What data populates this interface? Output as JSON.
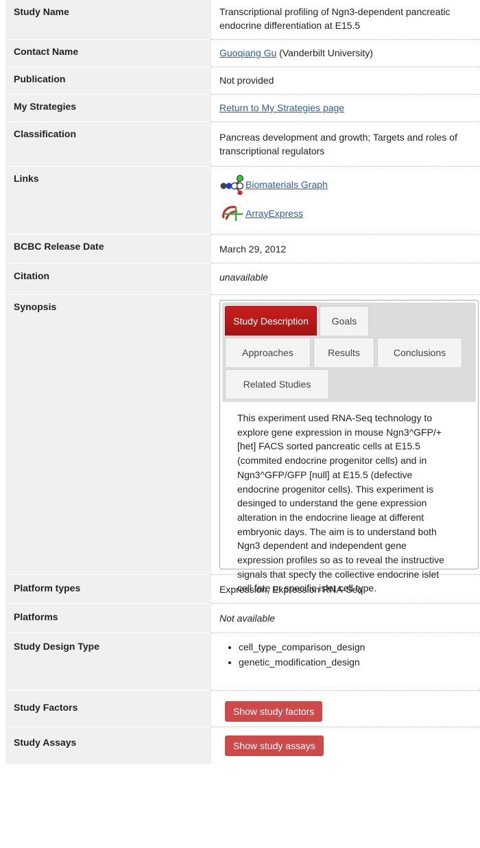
{
  "rows": {
    "study_name": {
      "label": "Study Name",
      "value": "Transcriptional profiling of Ngn3-dependent pancreatic endocrine differentiation at E15.5"
    },
    "contact": {
      "label": "Contact Name",
      "link": "Guoqiang Gu",
      "suffix": " (Vanderbilt University)"
    },
    "publication": {
      "label": "Publication",
      "value": "Not provided"
    },
    "strategies": {
      "label": "My Strategies",
      "link": "Return to My Strategies page"
    },
    "classification": {
      "label": "Classification",
      "value": "Pancreas development and growth; Targets and roles of transcriptional regulators"
    },
    "links": {
      "label": "Links",
      "biomaterials": "Biomaterials Graph",
      "arrayexpress": "ArrayExpress"
    },
    "release": {
      "label": "BCBC Release Date",
      "value": "March 29, 2012"
    },
    "citation": {
      "label": "Citation",
      "value": "unavailable"
    },
    "synopsis": {
      "label": "Synopsis",
      "tabs": [
        "Study Description",
        "Goals",
        "Approaches",
        "Results",
        "Conclusions",
        "Related Studies"
      ],
      "active_tab": "Study Description",
      "text": "This experiment used RNA-Seq technology to explore gene expression in mouse Ngn3^GFP/+ [het] FACS sorted pancreatic cells at E15.5 (commited endocrine progenitor cells) and in Ngn3^GFP/GFP [null] at E15.5 (defective endocrine progenitor cells). This experiment is desinged to understand the gene expression alteration in the endocrine lieage at different embryonic days. The aim is to understand both Ngn3 dependent and independent gene expression profiles so as to reveal the instructive signals that specfy the collective endocrine islet cell fate or specific islet cell type."
    },
    "platform_types": {
      "label": "Platform types",
      "value": "Expression, Expression RNA-Seq"
    },
    "platforms": {
      "label": "Platforms",
      "value": "Not available"
    },
    "design_type": {
      "label": "Study Design Type",
      "items": [
        "cell_type_comparison_design",
        "genetic_modification_design"
      ]
    },
    "factors": {
      "label": "Study Factors",
      "button": "Show study factors"
    },
    "assays": {
      "label": "Study Assays",
      "button": "Show study assays"
    }
  },
  "colors": {
    "active_tab": "#b81a1a",
    "button": "#cd4a4a",
    "link": "#2a5db0",
    "label_bg": "#f0f0f0"
  },
  "icons": [
    "biomaterials-graph-icon",
    "arrayexpress-icon"
  ]
}
